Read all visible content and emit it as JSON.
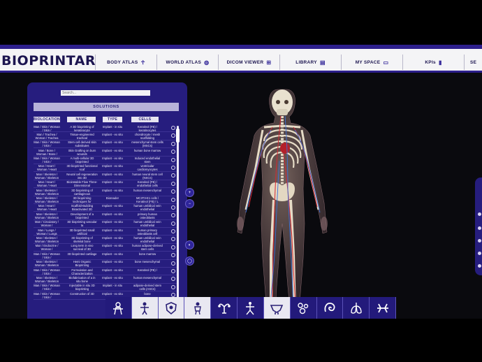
{
  "app": {
    "brand": "BIOPRINTAR"
  },
  "nav": [
    {
      "label": "BODY ATLAS",
      "icon": "body-icon",
      "glyph": "☥"
    },
    {
      "label": "WORLD ATLAS",
      "icon": "globe-icon",
      "glyph": "◍"
    },
    {
      "label": "DICOM VIEWER",
      "icon": "dicom-icon",
      "glyph": "⊞"
    },
    {
      "label": "LIBRARY",
      "icon": "library-icon",
      "glyph": "▤"
    },
    {
      "label": "MY SPACE",
      "icon": "folder-icon",
      "glyph": "▭"
    },
    {
      "label": "KPIs",
      "icon": "bar-chart-icon",
      "glyph": "▮"
    },
    {
      "label": "SE",
      "icon": "",
      "glyph": ""
    }
  ],
  "panel": {
    "search_placeholder": "Search...",
    "solutions_label": "SOLUTIONS",
    "columns": [
      "BIOLOCATION",
      "NAME",
      "TYPE",
      "CELLS"
    ],
    "rows": [
      [
        "Man / Skin / Woman / Skin /",
        "A 3D bioprinting of keratinocyte",
        "Implant - in situ",
        "Keratinol (FB) / keratinocytes"
      ],
      [
        "Man / Trachea / Woman / Trachea",
        "Tissue-engineered tracheal",
        "Implant - ex situ",
        "chondrocyte / mesh scaffolding"
      ],
      [
        "Man / Skin / Woman / Skin /",
        "Stem cell derived skin substitutes",
        "Implant - ex situ",
        "mesenchymal stem cells (MSCs)"
      ],
      [
        "Man / Bone / Woman / Bone /",
        "Skin Grafting on burn wounds",
        "Implant - ex situ",
        "human bone marrow"
      ],
      [
        "Man / Skin / Woman / Skin /",
        "A multi-cellular 3D bioprinted",
        "Implant - ex situ",
        "Induced endothelial stem"
      ],
      [
        "Man / Heart / Woman / Heart",
        "3D bioprinted functional scaf",
        "Implant - ex situ",
        "ventricular cardiomyocytes"
      ],
      [
        "Man / Skeleton / Woman / Skeleton",
        "Neural cell regeneration into 3D",
        "Implant - ex situ",
        "human neural stem cell (NSCs)"
      ],
      [
        "Man / Heart / Woman / Heart",
        "Bioinstable Flow Three-Dimensional",
        "Implant - ex situ",
        "Keratinol (FB) / endothelial cells"
      ],
      [
        "Man / Skeleton / Woman / Skeleton",
        "3D bioprinting of cartilaginous",
        "Implant - ex situ",
        "human mesenchymal"
      ],
      [
        "Man / Skeleton / Woman / Skeleton",
        "3D bioprinting techniques for",
        "Bioreader",
        "MC3T3-E1 cells / Keratinol (FB) / L"
      ],
      [
        "Man / Heart / Woman / Heart",
        "Scaffold-Building Bioactivated 3D",
        "Implant - ex situ",
        "human umbilical vein endothelial"
      ],
      [
        "Man / Skeleton / Woman / Skeleton",
        "Development of a bioprinted",
        "Implant - ex situ",
        "primary human osteoblasts"
      ],
      [
        "Man / Circulatory / Woman /",
        "3D bioprinting vascular ta",
        "Implant - ex situ",
        "human umbilical vein endothelial"
      ],
      [
        "Man / Lungs / Woman / Lungs",
        "3D bioprinted small artificial",
        "Implant - ex situ",
        "human primary osteoblasts cell"
      ],
      [
        "Man / Skeleton / Woman / Skeleton",
        "3D bioprinting of skeletal bone",
        "Implant - ex situ",
        "human umbilical vein endothelial"
      ],
      [
        "Man / Endocrine / Woman /",
        "Long term in vivo survival of 3D",
        "Implant - ex situ",
        "human adipose-derived stem cells"
      ],
      [
        "Man / Skin / Woman / Skin /",
        "3D bioprinted cartilage",
        "Implant - ex situ",
        "bone marrow"
      ],
      [
        "Man / Skeleton / Woman / Skeleton",
        "Hemi Organic Bioprinting",
        "Implant - ex situ",
        "bone mesenchymal"
      ],
      [
        "Man / Skin / Woman / Skin /",
        "Formulation and Characterization",
        "Implant - ex situ",
        "Keratinol (FB) /"
      ],
      [
        "Man / Skeleton / Woman / Skeleton",
        "Biofabrication of a in situ bone",
        "Implant - ex situ",
        "human mesenchymal"
      ],
      [
        "Man / Skin / Woman / Skin /",
        "Injectable in situ 3D bioprinting",
        "Implant - in situ",
        "adipose-derived stem cells (ASCs)"
      ],
      [
        "Man / Skin / Woman / Skin /",
        "Construction of 3D",
        "Implant - ex situ",
        "bone"
      ]
    ]
  },
  "side_buttons": [
    {
      "icon": "plus-icon",
      "glyph": "+"
    },
    {
      "icon": "minus-icon",
      "glyph": "−"
    },
    {
      "icon": "rotate-icon",
      "glyph": "◐"
    },
    {
      "icon": "lightbulb-icon",
      "glyph": "◯"
    }
  ],
  "bottom_tools": [
    {
      "name": "tool-full-body",
      "theme": "dark"
    },
    {
      "name": "tool-skin",
      "theme": "light"
    },
    {
      "name": "tool-skeleton",
      "theme": "light"
    },
    {
      "name": "tool-muscles",
      "theme": "light"
    },
    {
      "name": "tool-head",
      "theme": "dark"
    },
    {
      "name": "tool-nervous",
      "theme": "dark"
    },
    {
      "name": "tool-pelvis",
      "theme": "light"
    },
    {
      "name": "tool-cells",
      "theme": "dark"
    },
    {
      "name": "tool-intestine",
      "theme": "dark"
    },
    {
      "name": "tool-lungs",
      "theme": "dark"
    },
    {
      "name": "tool-vessels",
      "theme": "dark"
    }
  ],
  "colors": {
    "brand_navy": "#1c1550",
    "panel_purple": "#261d7e",
    "accent_purple": "#2d1f8c"
  }
}
